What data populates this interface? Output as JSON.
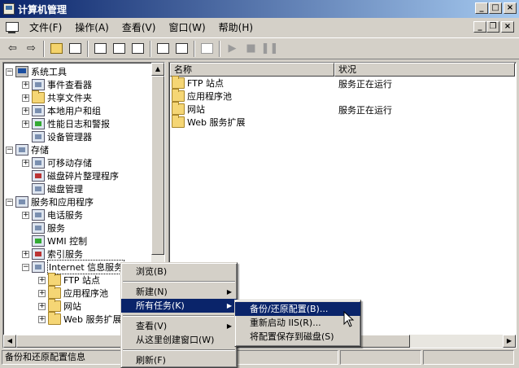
{
  "window": {
    "title": "计算机管理"
  },
  "menubar": {
    "items": [
      "文件(F)",
      "操作(A)",
      "查看(V)",
      "窗口(W)",
      "帮助(H)"
    ]
  },
  "toolbar": {
    "icons": [
      "back-arrow",
      "forward-arrow",
      "up-folder",
      "show-hide-tree",
      "properties",
      "refresh",
      "export-list",
      "help",
      "console",
      "play",
      "stop",
      "pause"
    ]
  },
  "tree": {
    "items": [
      {
        "label": "系统工具",
        "exp": "−"
      },
      {
        "label": "事件查看器",
        "exp": "+"
      },
      {
        "label": "共享文件夹",
        "exp": "+"
      },
      {
        "label": "本地用户和组",
        "exp": "+"
      },
      {
        "label": "性能日志和警报",
        "exp": "+"
      },
      {
        "label": "设备管理器",
        "exp": ""
      },
      {
        "label": "存储",
        "exp": "−"
      },
      {
        "label": "可移动存储",
        "exp": "+"
      },
      {
        "label": "磁盘碎片整理程序",
        "exp": ""
      },
      {
        "label": "磁盘管理",
        "exp": ""
      },
      {
        "label": "服务和应用程序",
        "exp": "−"
      },
      {
        "label": "电话服务",
        "exp": "+"
      },
      {
        "label": "服务",
        "exp": ""
      },
      {
        "label": "WMI 控制",
        "exp": ""
      },
      {
        "label": "索引服务",
        "exp": "+"
      },
      {
        "label": "Internet 信息服务",
        "exp": "−"
      },
      {
        "label": "FTP 站点",
        "exp": "+"
      },
      {
        "label": "应用程序池",
        "exp": "+"
      },
      {
        "label": "网站",
        "exp": "+"
      },
      {
        "label": "Web 服务扩展",
        "exp": "+"
      }
    ]
  },
  "list": {
    "headers": [
      "名称",
      "状况"
    ],
    "rows": [
      {
        "name": "FTP 站点",
        "status": "服务正在运行"
      },
      {
        "name": "应用程序池",
        "status": ""
      },
      {
        "name": "网站",
        "status": "服务正在运行"
      },
      {
        "name": "Web 服务扩展",
        "status": ""
      }
    ]
  },
  "status": {
    "text": "备份和还原配置信息"
  },
  "context_menu": {
    "items": [
      "浏览(B)",
      "新建(N)",
      "所有任务(K)",
      "查看(V)",
      "从这里创建窗口(W)",
      "刷新(F)"
    ]
  },
  "submenu": {
    "items": [
      "备份/还原配置(B)...",
      "重新启动 IIS(R)...",
      "将配置保存到磁盘(S)"
    ]
  },
  "colors": {
    "titlebar": "#0a246a",
    "highlight": "#0a246a",
    "face": "#d4d0c8"
  }
}
